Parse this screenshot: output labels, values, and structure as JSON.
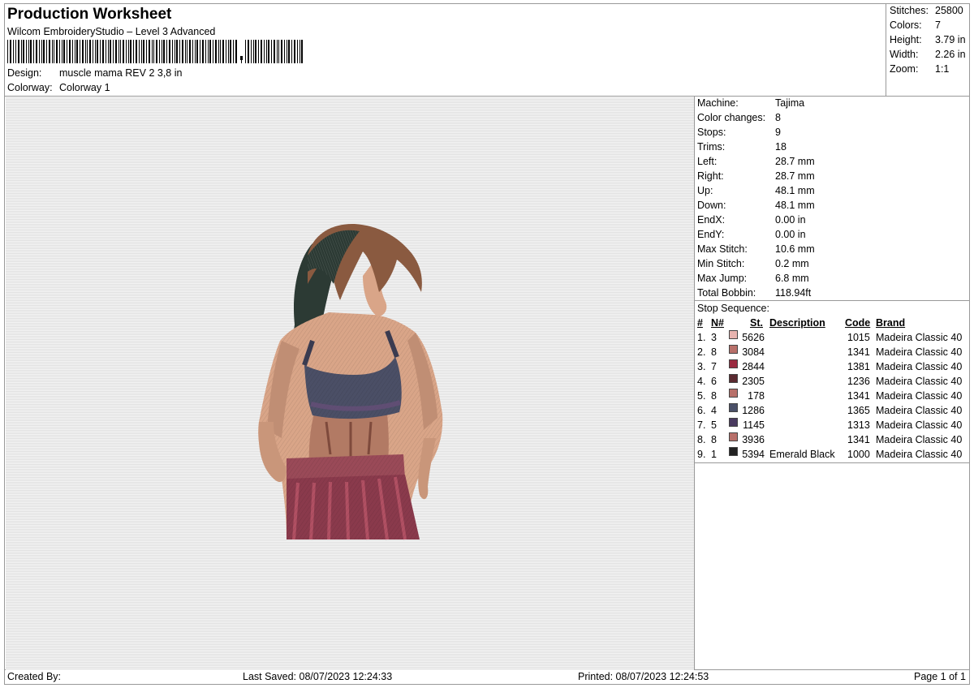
{
  "header": {
    "title": "Production Worksheet",
    "software": "Wilcom EmbroideryStudio – Level 3 Advanced",
    "design_label": "Design:",
    "design_value": "muscle mama REV 2 3,8 in",
    "colorway_label": "Colorway:",
    "colorway_value": "Colorway 1"
  },
  "stats": [
    {
      "label": "Stitches:",
      "value": "25800"
    },
    {
      "label": "Colors:",
      "value": "7"
    },
    {
      "label": "Height:",
      "value": "3.79 in"
    },
    {
      "label": "Width:",
      "value": "2.26 in"
    },
    {
      "label": "Zoom:",
      "value": "1:1"
    }
  ],
  "machine_info": [
    {
      "label": "Machine:",
      "value": "Tajima"
    },
    {
      "label": "Color changes:",
      "value": "8"
    },
    {
      "label": "Stops:",
      "value": "9"
    },
    {
      "label": "Trims:",
      "value": "18"
    },
    {
      "label": "Left:",
      "value": "28.7 mm"
    },
    {
      "label": "Right:",
      "value": "28.7 mm"
    },
    {
      "label": "Up:",
      "value": "48.1 mm"
    },
    {
      "label": "Down:",
      "value": "48.1 mm"
    },
    {
      "label": "EndX:",
      "value": "0.00 in"
    },
    {
      "label": "EndY:",
      "value": "0.00 in"
    },
    {
      "label": "Max Stitch:",
      "value": "10.6 mm"
    },
    {
      "label": "Min Stitch:",
      "value": "0.2 mm"
    },
    {
      "label": "Max Jump:",
      "value": "6.8 mm"
    },
    {
      "label": "Total Bobbin:",
      "value": "118.94ft"
    }
  ],
  "stop_sequence": {
    "title": "Stop Sequence:",
    "headers": {
      "num": "#",
      "n": "N#",
      "st": "St.",
      "desc": "Description",
      "code": "Code",
      "brand": "Brand"
    },
    "rows": [
      {
        "num": "1.",
        "n": "3",
        "color": "#e8b4b0",
        "st": "5626",
        "desc": "",
        "code": "1015",
        "brand": "Madeira Classic 40"
      },
      {
        "num": "2.",
        "n": "8",
        "color": "#b8706a",
        "st": "3084",
        "desc": "",
        "code": "1341",
        "brand": "Madeira Classic 40"
      },
      {
        "num": "3.",
        "n": "7",
        "color": "#9a2a40",
        "st": "2844",
        "desc": "",
        "code": "1381",
        "brand": "Madeira Classic 40"
      },
      {
        "num": "4.",
        "n": "6",
        "color": "#5a2a30",
        "st": "2305",
        "desc": "",
        "code": "1236",
        "brand": "Madeira Classic 40"
      },
      {
        "num": "5.",
        "n": "8",
        "color": "#b8706a",
        "st": "178",
        "desc": "",
        "code": "1341",
        "brand": "Madeira Classic 40"
      },
      {
        "num": "6.",
        "n": "4",
        "color": "#4a5068",
        "st": "1286",
        "desc": "",
        "code": "1365",
        "brand": "Madeira Classic 40"
      },
      {
        "num": "7.",
        "n": "5",
        "color": "#4a3a60",
        "st": "1145",
        "desc": "",
        "code": "1313",
        "brand": "Madeira Classic 40"
      },
      {
        "num": "8.",
        "n": "8",
        "color": "#b8706a",
        "st": "3936",
        "desc": "",
        "code": "1341",
        "brand": "Madeira Classic 40"
      },
      {
        "num": "9.",
        "n": "1",
        "color": "#222222",
        "st": "5394",
        "desc": "Emerald Black",
        "code": "1000",
        "brand": "Madeira Classic 40"
      }
    ]
  },
  "footer": {
    "created_by": "Created By:",
    "last_saved": "Last Saved: 08/07/2023 12:24:33",
    "printed": "Printed: 08/07/2023 12:24:53",
    "page": "Page 1 of 1"
  }
}
